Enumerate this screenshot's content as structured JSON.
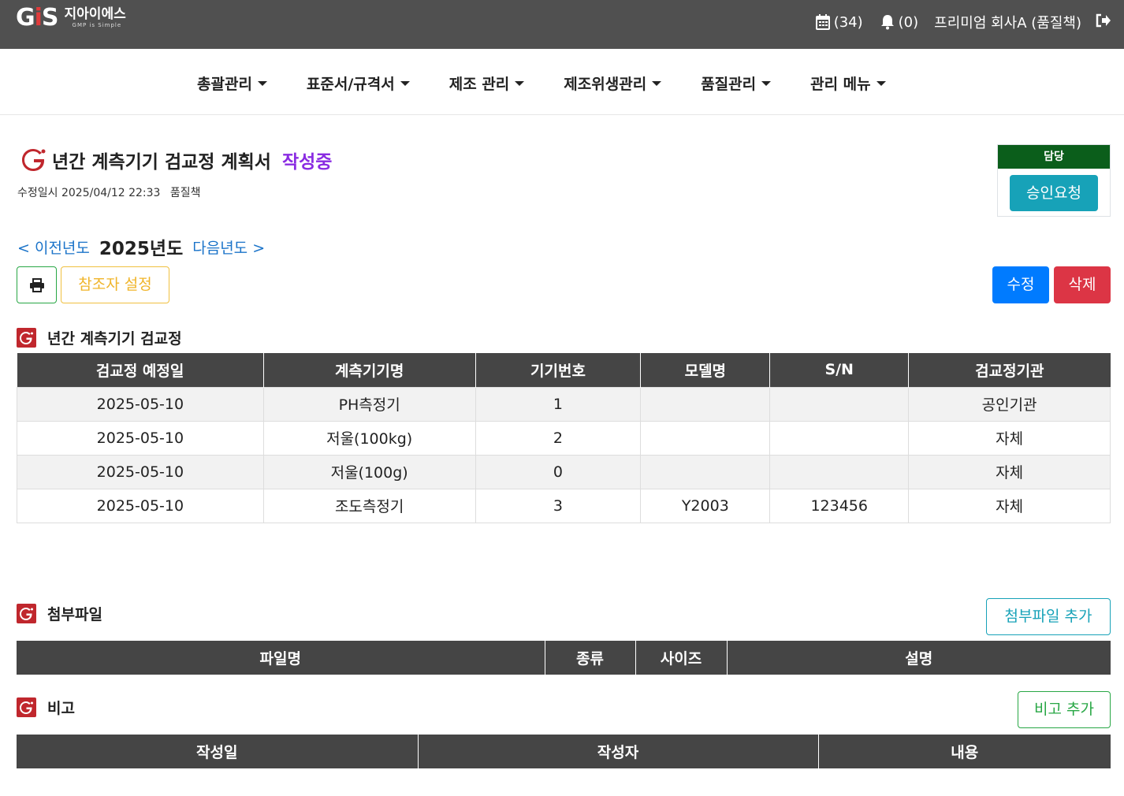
{
  "header": {
    "logo_mark": "GiS",
    "logo_kr": "지아이에스",
    "logo_sub": "GMP is Simple",
    "calendar_count": "(34)",
    "notification_count": "(0)",
    "user": "프리미엄 회사A (품질책)"
  },
  "nav": {
    "items": [
      "총괄관리",
      "표준서/규격서",
      "제조 관리",
      "제조위생관리",
      "품질관리",
      "관리 메뉴"
    ]
  },
  "page": {
    "title": "년간 계측기기 검교정 계획서",
    "status": "작성중",
    "modified_label": "수정일시 2025/04/12 22:33",
    "modified_by": "품질책",
    "approval_header": "담당",
    "approval_button": "승인요청",
    "prev_year": "< 이전년도",
    "current_year": "2025년도",
    "next_year": "다음년도 >",
    "ref_button": "참조자 설정",
    "edit_button": "수정",
    "delete_button": "삭제"
  },
  "calibration": {
    "title": "년간 계측기기 검교정",
    "headers": [
      "검교정 예정일",
      "계측기기명",
      "기기번호",
      "모델명",
      "S/N",
      "검교정기관"
    ],
    "rows": [
      [
        "2025-05-10",
        "PH측정기",
        "1",
        "",
        "",
        "공인기관"
      ],
      [
        "2025-05-10",
        "저울(100kg)",
        "2",
        "",
        "",
        "자체"
      ],
      [
        "2025-05-10",
        "저울(100g)",
        "0",
        "",
        "",
        "자체"
      ],
      [
        "2025-05-10",
        "조도측정기",
        "3",
        "Y2003",
        "123456",
        "자체"
      ]
    ]
  },
  "attachments": {
    "title": "첨부파일",
    "add_button": "첨부파일 추가",
    "headers": [
      "파일명",
      "종류",
      "사이즈",
      "설명"
    ]
  },
  "remarks": {
    "title": "비고",
    "add_button": "비고 추가",
    "headers": [
      "작성일",
      "작성자",
      "내용"
    ]
  }
}
